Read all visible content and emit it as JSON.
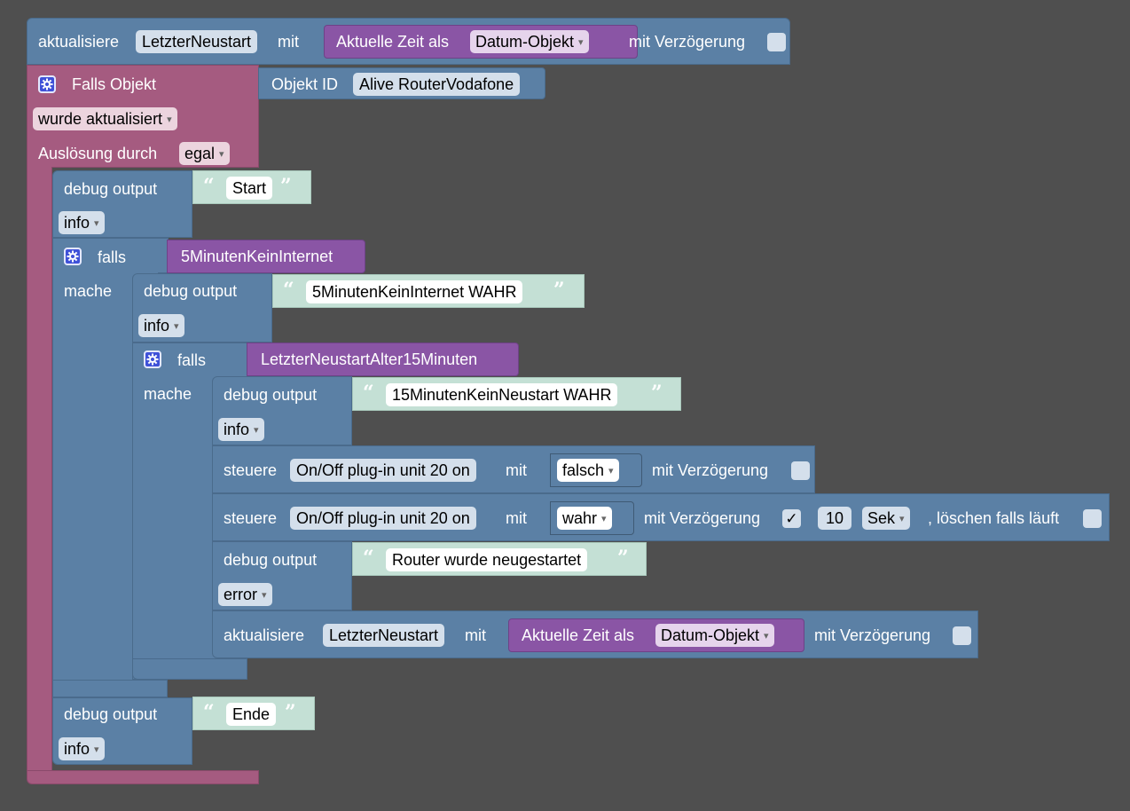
{
  "top_update": {
    "keyword": "aktualisiere",
    "variable": "LetzterNeustart",
    "with": "mit",
    "time_label": "Aktuelle Zeit als",
    "time_format": "Datum-Objekt",
    "delay_label": "mit Verzögerung",
    "delay_checked": false
  },
  "trigger": {
    "title": "Falls Objekt",
    "object_id_label": "Objekt ID",
    "object_id_value": "Alive RouterVodafone",
    "event": "wurde aktualisiert",
    "trigger_label": "Auslösung durch",
    "trigger_value": "egal"
  },
  "debug_start": {
    "label": "debug output",
    "text": "Start",
    "level": "info"
  },
  "if1": {
    "label": "falls",
    "condition": "5MinutenKeinInternet",
    "do_label": "mache",
    "debug": {
      "label": "debug output",
      "text": "5MinutenKeinInternet WAHR",
      "level": "info"
    }
  },
  "if2": {
    "label": "falls",
    "condition": "LetzterNeustartAlter15Minuten",
    "do_label": "mache",
    "debug1": {
      "label": "debug output",
      "text": "15MinutenKeinNeustart WAHR",
      "level": "info"
    },
    "control1": {
      "keyword": "steuere",
      "device": "On/Off plug-in unit 20 on",
      "with": "mit",
      "value": "falsch",
      "delay_label": "mit Verzögerung",
      "delay_checked": false
    },
    "control2": {
      "keyword": "steuere",
      "device": "On/Off plug-in unit 20 on",
      "with": "mit",
      "value": "wahr",
      "delay_label": "mit Verzögerung",
      "delay_check_glyph": "✓",
      "delay_amount": "10",
      "delay_unit": "Sek",
      "clear_label": ", löschen falls läuft",
      "clear_checked": false
    },
    "debug2": {
      "label": "debug output",
      "text": "Router wurde neugestartet",
      "level": "error"
    },
    "update": {
      "keyword": "aktualisiere",
      "variable": "LetzterNeustart",
      "with": "mit",
      "time_label": "Aktuelle Zeit als",
      "time_format": "Datum-Objekt",
      "delay_label": "mit Verzögerung",
      "delay_checked": false
    }
  },
  "debug_end": {
    "label": "debug output",
    "text": "Ende",
    "level": "info"
  },
  "glyphs": {
    "open_quote": "“",
    "close_quote": "”",
    "dropdown_arrow": "▾"
  },
  "colors": {
    "workspace": "#4f4f4f",
    "logic_blue": "#5b80a5",
    "trigger_pink": "#a55b80",
    "variable_purple": "#8a55a5",
    "text_teal": "#c4e0d5",
    "gear_blue": "#3f51d8"
  },
  "icons": {
    "mutator": "gear-icon",
    "dropdown": "chevron-down-icon"
  }
}
